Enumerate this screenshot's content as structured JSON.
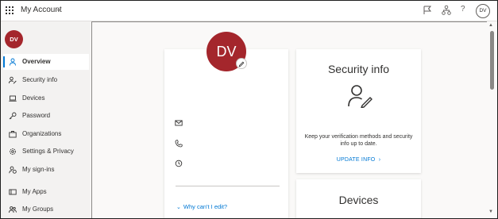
{
  "header": {
    "app_title": "My Account",
    "help_label": "?",
    "avatar_initials": "DV"
  },
  "sidebar": {
    "avatar_initials": "DV",
    "items": [
      {
        "label": "Overview",
        "icon": "person-icon",
        "active": true
      },
      {
        "label": "Security info",
        "icon": "security-info-icon"
      },
      {
        "label": "Devices",
        "icon": "laptop-icon"
      },
      {
        "label": "Password",
        "icon": "key-icon"
      },
      {
        "label": "Organizations",
        "icon": "briefcase-icon"
      },
      {
        "label": "Settings & Privacy",
        "icon": "gear-icon"
      },
      {
        "label": "My sign-ins",
        "icon": "sign-ins-icon"
      },
      {
        "label": "My Apps",
        "icon": "apps-icon"
      },
      {
        "label": "My Groups",
        "icon": "groups-icon"
      }
    ]
  },
  "profile_card": {
    "avatar_initials": "DV",
    "why_cant_edit": "Why can't I edit?"
  },
  "security_card": {
    "title": "Security info",
    "description": "Keep your verification methods and security info up to date.",
    "link": "UPDATE INFO"
  },
  "devices_card": {
    "title": "Devices"
  },
  "colors": {
    "accent": "#0078d4",
    "avatar": "#a4262c"
  }
}
